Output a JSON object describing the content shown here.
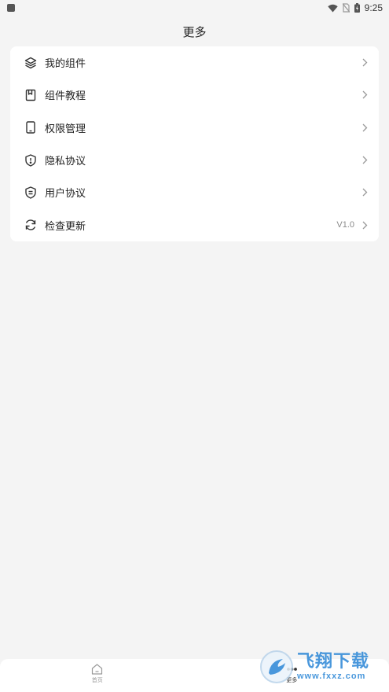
{
  "status_bar": {
    "time": "9:25"
  },
  "header": {
    "title": "更多"
  },
  "menu": {
    "items": [
      {
        "label": "我的组件",
        "icon": "layers-icon",
        "value": ""
      },
      {
        "label": "组件教程",
        "icon": "bookmark-book-icon",
        "value": ""
      },
      {
        "label": "权限管理",
        "icon": "phone-device-icon",
        "value": ""
      },
      {
        "label": "隐私协议",
        "icon": "shield-alert-icon",
        "value": ""
      },
      {
        "label": "用户协议",
        "icon": "shield-doc-icon",
        "value": ""
      },
      {
        "label": "检查更新",
        "icon": "refresh-icon",
        "value": "V1.0"
      }
    ]
  },
  "bottom_nav": {
    "items": [
      {
        "label": "首页",
        "icon": "home-icon",
        "active": false
      },
      {
        "label": "更多",
        "icon": "more-icon",
        "active": true
      }
    ]
  },
  "watermark": {
    "title": "飞翔下载",
    "subtitle": "www.fxxz.com"
  },
  "colors": {
    "background": "#f4f4f4",
    "card": "#ffffff",
    "watermark": "#2a86d6"
  }
}
